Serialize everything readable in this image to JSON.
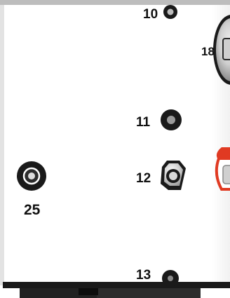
{
  "figure": {
    "panel_color": "#ffffff",
    "edge_color": "#1a1a1a",
    "accent_color": "#e03a22",
    "callouts": [
      {
        "id": "10",
        "text": "10"
      },
      {
        "id": "11",
        "text": "11"
      },
      {
        "id": "12",
        "text": "12"
      },
      {
        "id": "13",
        "text": "13"
      },
      {
        "id": "18",
        "text": "18"
      },
      {
        "id": "25",
        "text": "25"
      }
    ]
  }
}
